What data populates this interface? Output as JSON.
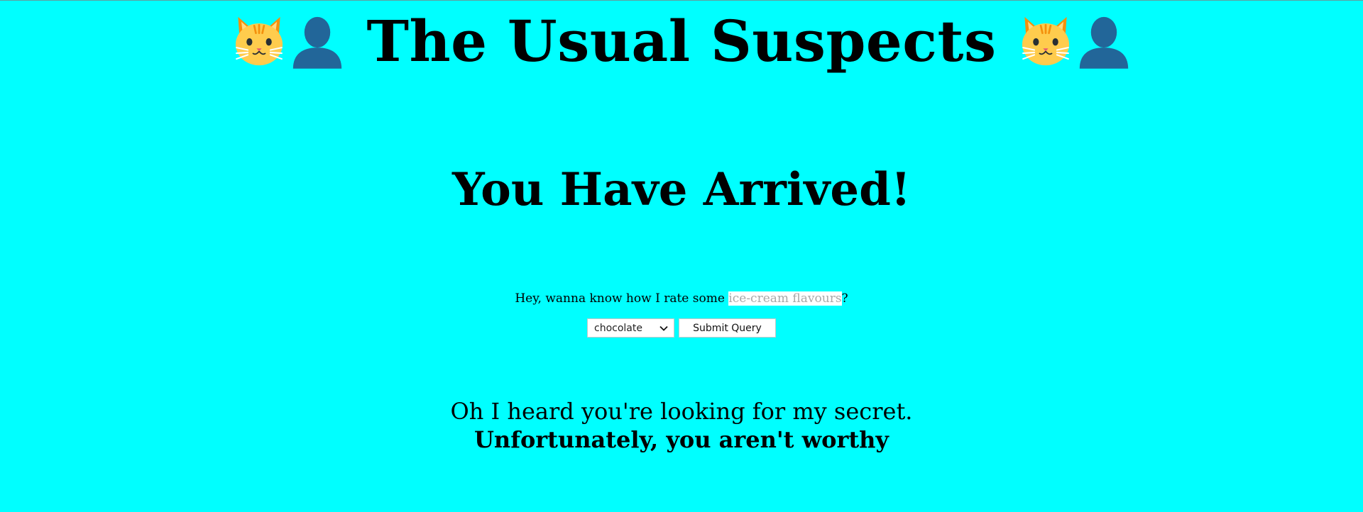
{
  "header": {
    "title": "The Usual Suspects",
    "icons": [
      "cat-face-icon",
      "bust-silhouette-icon"
    ]
  },
  "main": {
    "heading": "You Have Arrived!",
    "prompt": {
      "before": "Hey, wanna know how I rate some ",
      "highlight": "ice-cream flavours",
      "after": "?"
    },
    "form": {
      "select_value": "chocolate",
      "submit_label": "Submit Query"
    },
    "secret": {
      "line1": "Oh I heard you're looking for my secret.",
      "line2": "Unfortunately, you aren't worthy"
    }
  },
  "colors": {
    "background": "#00ffff",
    "text": "#000000",
    "highlight_bg": "#ffffff",
    "highlight_text": "#a9a9a9"
  }
}
